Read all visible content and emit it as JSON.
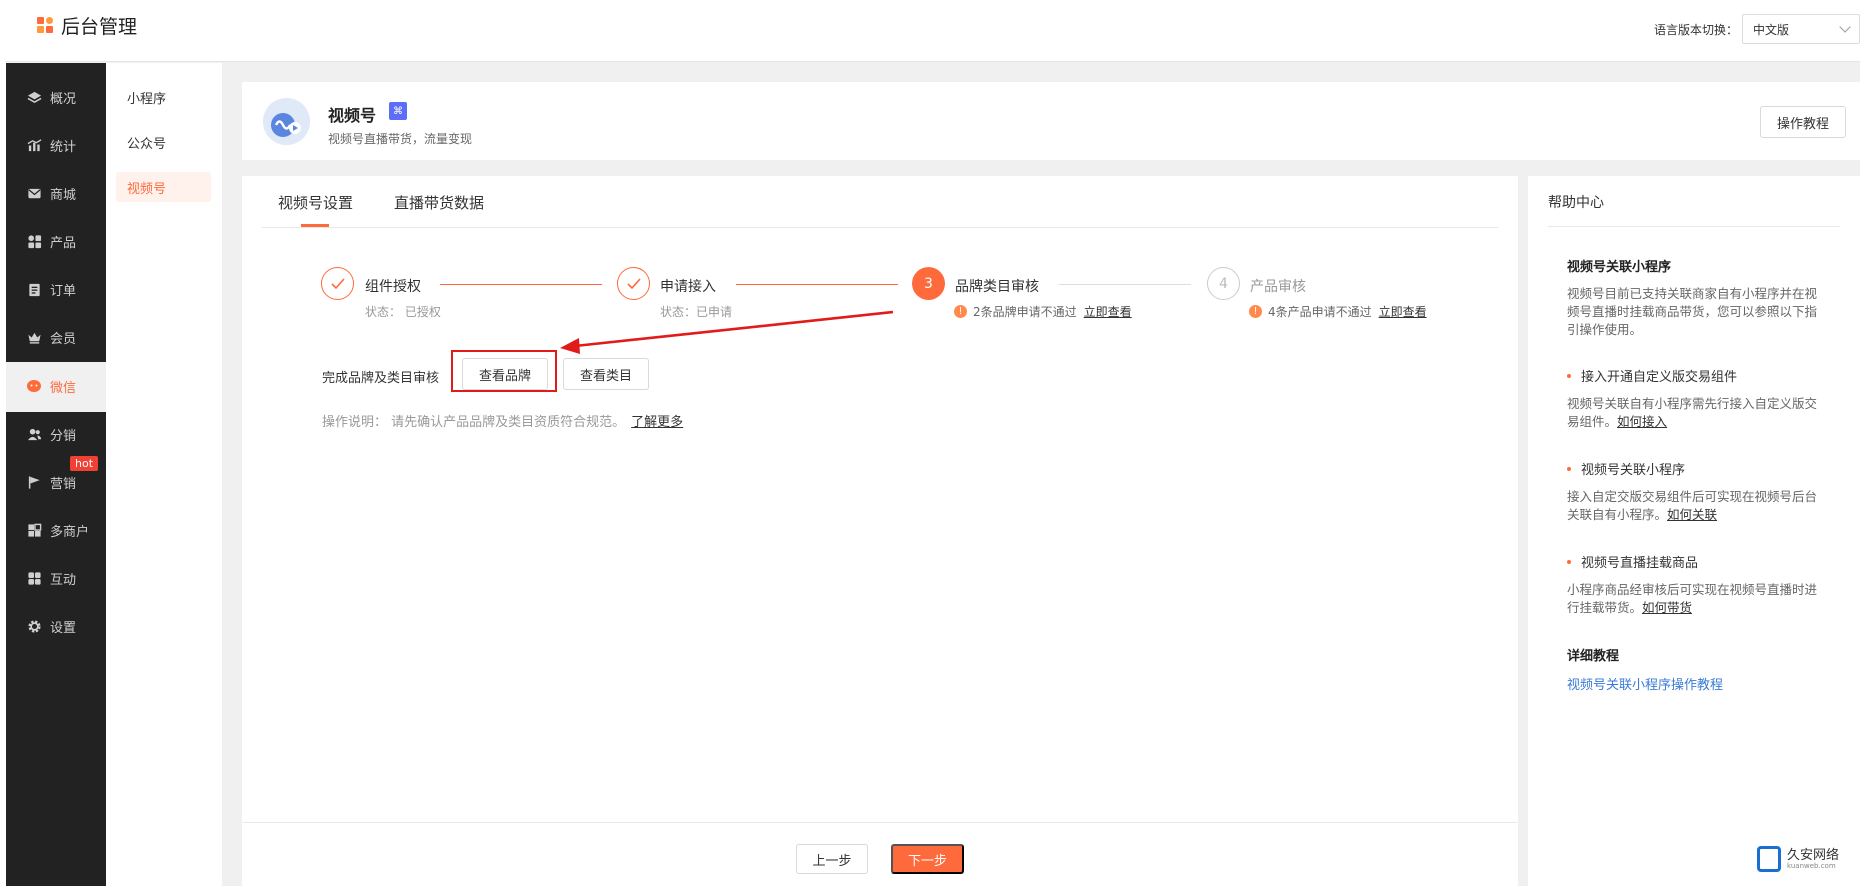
{
  "app": {
    "title": "后台管理"
  },
  "header": {
    "lang_label": "语言版本切换：",
    "lang_value": "中文版"
  },
  "sidebar": {
    "items": [
      {
        "label": "概况",
        "icon": "layers-icon"
      },
      {
        "label": "统计",
        "icon": "chart-icon"
      },
      {
        "label": "商城",
        "icon": "mail-icon"
      },
      {
        "label": "产品",
        "icon": "grid-icon"
      },
      {
        "label": "订单",
        "icon": "clipboard-icon"
      },
      {
        "label": "会员",
        "icon": "crown-icon"
      },
      {
        "label": "微信",
        "icon": "wechat-icon",
        "active": true
      },
      {
        "label": "分销",
        "icon": "users-icon"
      },
      {
        "label": "营销",
        "icon": "flag-icon",
        "badge": "hot"
      },
      {
        "label": "多商户",
        "icon": "store-icon"
      },
      {
        "label": "互动",
        "icon": "apps-icon"
      },
      {
        "label": "设置",
        "icon": "gear-icon"
      }
    ]
  },
  "subnav": {
    "items": [
      {
        "label": "小程序"
      },
      {
        "label": "公众号"
      },
      {
        "label": "视频号",
        "active": true
      }
    ]
  },
  "page": {
    "title": "视频号",
    "badge": "⌘",
    "subtitle": "视频号直播带货，流量变现",
    "tutorial_button": "操作教程"
  },
  "tabs": [
    {
      "label": "视频号设置",
      "active": true
    },
    {
      "label": "直播带货数据"
    }
  ],
  "steps": [
    {
      "title": "组件授权",
      "status": "状态：  已授权",
      "state": "done"
    },
    {
      "title": "申请接入",
      "status": "状态：已申请",
      "state": "done"
    },
    {
      "num": "3",
      "title": "品牌类目审核",
      "warn": "2条品牌申请不通过",
      "link": "立即查看",
      "state": "current"
    },
    {
      "num": "4",
      "title": "产品审核",
      "warn": "4条产品申请不通过",
      "link": "立即查看",
      "state": "todo"
    }
  ],
  "review": {
    "label": "完成品牌及类目审核",
    "view_brand": "查看品牌",
    "view_category": "查看类目",
    "note": "操作说明： 请先确认产品品牌及类目资质符合规范。",
    "note_link": "了解更多"
  },
  "footer": {
    "prev": "上一步",
    "next": "下一步"
  },
  "help": {
    "title": "帮助中心",
    "section1_title": "视频号关联小程序",
    "section1_text": "视频号目前已支持关联商家自有小程序并在视频号直播时挂载商品带货，您可以参照以下指引操作使用。",
    "bullet1": "接入开通自定义版交易组件",
    "bullet1_text": "视频号关联自有小程序需先行接入自定义版交易组件。",
    "bullet1_link": "如何接入",
    "bullet2": "视频号关联小程序",
    "bullet2_text": "接入自定交版交易组件后可实现在视频号后台关联自有小程序。",
    "bullet2_link": "如何关联",
    "bullet3": "视频号直播挂载商品",
    "bullet3_text": "小程序商品经审核后可实现在视频号直播时进行挂载带货。",
    "bullet3_link": "如何带货",
    "detail_title": "详细教程",
    "detail_link": "视频号关联小程序操作教程"
  },
  "watermark": {
    "name": "久安网络",
    "domain": "kuanweb.com"
  },
  "colors": {
    "accent": "#ff6a3c",
    "sidebar_bg": "#222222",
    "annotation_red": "#e11a1a",
    "link_blue": "#3a7bd5"
  }
}
